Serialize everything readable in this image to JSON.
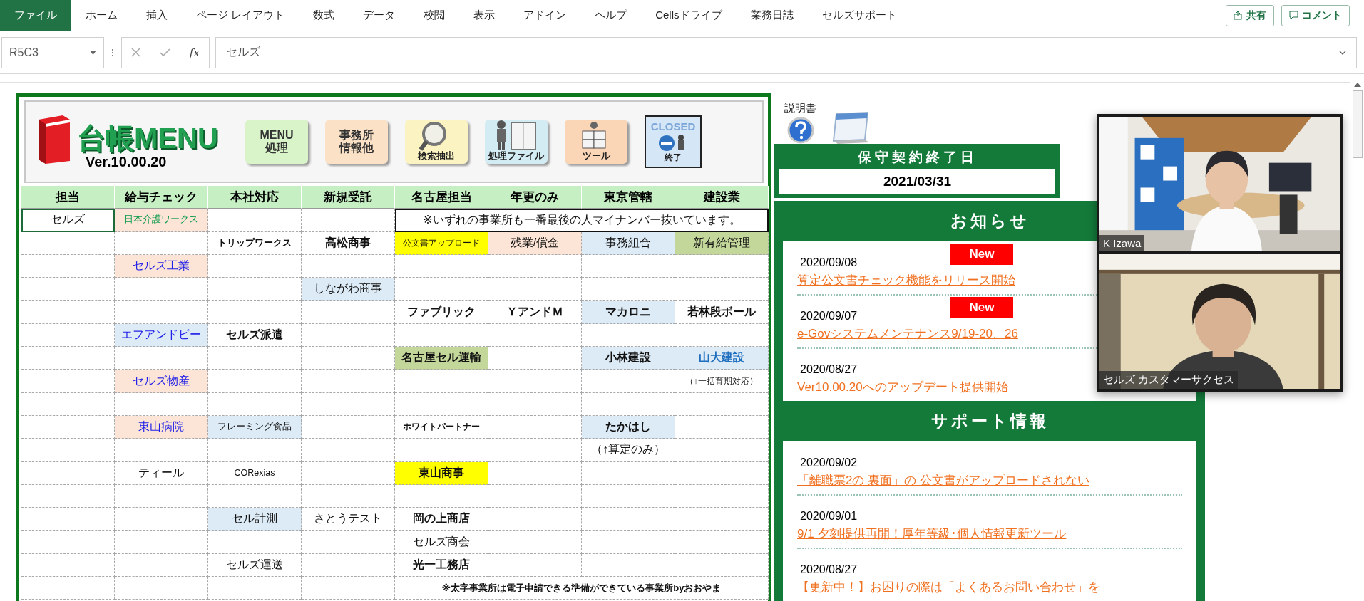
{
  "ribbon": {
    "tabs": [
      {
        "label": "ファイル",
        "selected": true
      },
      {
        "label": "ホーム",
        "selected": false
      },
      {
        "label": "挿入",
        "selected": false
      },
      {
        "label": "ページ レイアウト",
        "selected": false
      },
      {
        "label": "数式",
        "selected": false
      },
      {
        "label": "データ",
        "selected": false
      },
      {
        "label": "校閲",
        "selected": false
      },
      {
        "label": "表示",
        "selected": false
      },
      {
        "label": "アドイン",
        "selected": false
      },
      {
        "label": "ヘルプ",
        "selected": false
      },
      {
        "label": "Cellsドライブ",
        "selected": false
      },
      {
        "label": "業務日誌",
        "selected": false
      },
      {
        "label": "セルズサポート",
        "selected": false
      }
    ],
    "actions": [
      {
        "kind": "share",
        "label": "共有"
      },
      {
        "kind": "comment",
        "label": "コメント"
      }
    ]
  },
  "formula_bar": {
    "name_box": "R5C3",
    "fx": "fx",
    "value": "セルズ"
  },
  "menu": {
    "title": "台帳MENU",
    "version": "Ver.10.00.20",
    "buttons": [
      {
        "kind": "text",
        "lines": [
          "MENU",
          "処理"
        ],
        "color": "#d9f4c9"
      },
      {
        "kind": "text",
        "lines": [
          "事務所",
          "情報他"
        ],
        "color": "#fbe2c6"
      },
      {
        "kind": "search",
        "lines": [
          "検索抽出"
        ],
        "color": "#fbf3c2"
      },
      {
        "kind": "file",
        "lines": [
          "処理ファイル"
        ],
        "color": "#d3ecf3"
      },
      {
        "kind": "tool",
        "lines": [
          "ツール"
        ],
        "color": "#fad5b6"
      },
      {
        "kind": "closed",
        "lines": [
          "CLOSED",
          "終了"
        ],
        "color": "#d5e6f6"
      }
    ]
  },
  "grid": {
    "columns": [
      "担当",
      "給与チェック",
      "本社対応",
      "新規受託",
      "名古屋担当",
      "年更のみ",
      "東京管轄",
      "建設業"
    ],
    "rows": [
      {
        "cells": [
          {
            "text": "セルズ",
            "selected": true
          },
          {
            "text": "日本介護ワークス",
            "kind": "peach",
            "color": "#0a9a4a",
            "selected": false
          },
          {
            "selected": false
          },
          {
            "selected": false
          },
          {
            "text": "※いずれの事業所も一番最後の人マイナンバー抜いています。",
            "kind": "note",
            "selected": false
          }
        ]
      },
      {
        "cells": [
          {
            "selected": false
          },
          {
            "selected": false
          },
          {
            "text": "トリップワークス",
            "bold": true,
            "selected": false
          },
          {
            "text": "高松商事",
            "bold": true,
            "selected": false
          },
          {
            "text": "公文書アップロード",
            "kind": "yellow",
            "selected": false
          },
          {
            "text": "残業/償金",
            "kind": "peach",
            "selected": false
          },
          {
            "text": "事務組合",
            "kind": "blue",
            "selected": false
          },
          {
            "text": "新有給管理",
            "kind": "olive",
            "selected": false
          }
        ]
      },
      {
        "cells": [
          {
            "selected": false
          },
          {
            "text": "セルズ工業",
            "kind": "peach",
            "color": "#2020e8",
            "selected": false
          },
          {
            "selected": false
          },
          {
            "selected": false
          },
          {
            "selected": false
          },
          {
            "selected": false
          },
          {
            "selected": false
          },
          {
            "selected": false
          }
        ]
      },
      {
        "cells": [
          {
            "selected": false
          },
          {
            "selected": false
          },
          {
            "selected": false
          },
          {
            "text": "しながわ商事",
            "kind": "blue",
            "selected": false
          },
          {
            "selected": false
          },
          {
            "selected": false
          },
          {
            "selected": false
          },
          {
            "selected": false
          }
        ]
      },
      {
        "cells": [
          {
            "selected": false
          },
          {
            "selected": false
          },
          {
            "selected": false
          },
          {
            "selected": false
          },
          {
            "text": "ファブリック",
            "bold": true,
            "selected": false
          },
          {
            "text": "ＹアンドＭ",
            "bold": true,
            "selected": false
          },
          {
            "text": "マカロニ",
            "kind": "blue",
            "bold": true,
            "selected": false
          },
          {
            "text": "若林段ボール",
            "bold": true,
            "selected": false
          }
        ]
      },
      {
        "cells": [
          {
            "selected": false
          },
          {
            "text": "エフアンドビー",
            "kind": "blue",
            "color": "#2020e8",
            "selected": false
          },
          {
            "text": "セルズ派遣",
            "bold": true,
            "selected": false
          },
          {
            "selected": false
          },
          {
            "selected": false
          },
          {
            "selected": false
          },
          {
            "selected": false
          },
          {
            "selected": false
          }
        ]
      },
      {
        "cells": [
          {
            "selected": false
          },
          {
            "selected": false
          },
          {
            "selected": false
          },
          {
            "selected": false
          },
          {
            "text": "名古屋セル運輸",
            "kind": "olive",
            "bold": true,
            "selected": false
          },
          {
            "selected": false
          },
          {
            "text": "小林建設",
            "kind": "blue",
            "bold": true,
            "selected": false
          },
          {
            "text": "山大建設",
            "kind": "blue",
            "bold": true,
            "color": "#1f6fbf",
            "selected": false
          }
        ]
      },
      {
        "cells": [
          {
            "selected": false
          },
          {
            "text": "セルズ物産",
            "kind": "peach",
            "color": "#2020e8",
            "selected": false
          },
          {
            "selected": false
          },
          {
            "selected": false
          },
          {
            "selected": false
          },
          {
            "selected": false
          },
          {
            "selected": false
          },
          {
            "text": "（↑一括育期対応）",
            "selected": false
          }
        ]
      },
      {
        "cells": [
          {
            "selected": false
          },
          {
            "selected": false
          },
          {
            "selected": false
          },
          {
            "selected": false
          },
          {
            "selected": false
          },
          {
            "selected": false
          },
          {
            "selected": false
          },
          {
            "selected": false
          }
        ]
      },
      {
        "cells": [
          {
            "selected": false
          },
          {
            "text": "東山病院",
            "kind": "peach",
            "color": "#2020e8",
            "selected": false
          },
          {
            "text": "フレーミング食品",
            "kind": "blue",
            "selected": false
          },
          {
            "selected": false
          },
          {
            "text": "ホワイトパートナー",
            "bold": true,
            "selected": false
          },
          {
            "selected": false
          },
          {
            "text": "たかはし",
            "kind": "blue",
            "bold": true,
            "selected": false
          },
          {
            "selected": false
          }
        ]
      },
      {
        "cells": [
          {
            "selected": false
          },
          {
            "selected": false
          },
          {
            "selected": false
          },
          {
            "selected": false
          },
          {
            "selected": false
          },
          {
            "selected": false
          },
          {
            "text": "（↑算定のみ）",
            "selected": false
          },
          {
            "selected": false
          }
        ]
      },
      {
        "cells": [
          {
            "selected": false
          },
          {
            "text": "ティール",
            "selected": false
          },
          {
            "text": "CORexias",
            "selected": false
          },
          {
            "selected": false
          },
          {
            "text": "東山商事",
            "kind": "yellow",
            "bold": true,
            "selected": false
          },
          {
            "selected": false
          },
          {
            "selected": false
          },
          {
            "selected": false
          }
        ]
      },
      {
        "cells": [
          {
            "selected": false
          },
          {
            "selected": false
          },
          {
            "selected": false
          },
          {
            "selected": false
          },
          {
            "selected": false
          },
          {
            "selected": false
          },
          {
            "selected": false
          },
          {
            "selected": false
          }
        ]
      },
      {
        "cells": [
          {
            "selected": false
          },
          {
            "selected": false
          },
          {
            "text": "セル計測",
            "kind": "blue",
            "selected": false
          },
          {
            "text": "さとうテスト",
            "selected": false
          },
          {
            "text": "岡の上商店",
            "bold": true,
            "selected": false
          },
          {
            "selected": false
          },
          {
            "selected": false
          },
          {
            "selected": false
          }
        ]
      },
      {
        "cells": [
          {
            "selected": false
          },
          {
            "selected": false
          },
          {
            "selected": false
          },
          {
            "selected": false
          },
          {
            "text": "セルズ商会",
            "selected": false
          },
          {
            "selected": false
          },
          {
            "selected": false
          },
          {
            "selected": false
          }
        ]
      },
      {
        "cells": [
          {
            "selected": false
          },
          {
            "selected": false
          },
          {
            "text": "セルズ運送",
            "selected": false
          },
          {
            "selected": false
          },
          {
            "text": "光一工務店",
            "bold": true,
            "selected": false
          },
          {
            "selected": false
          },
          {
            "selected": false
          },
          {
            "selected": false
          }
        ]
      },
      {
        "cells": [
          {
            "selected": false
          },
          {
            "selected": false
          },
          {
            "selected": false
          },
          {
            "selected": false
          },
          {
            "text": "※太字事業所は電子申請できる準備ができている事業所byおおやま",
            "kind": "note",
            "bold": true,
            "selected": false
          }
        ]
      }
    ]
  },
  "manual": {
    "label": "説明書"
  },
  "contract": {
    "title": "保守契約終了日",
    "date": "2021/03/31"
  },
  "notices": {
    "title": "お知らせ",
    "items": [
      {
        "date": "2020/09/08",
        "title": "算定公文書チェック機能をリリース開始",
        "new": true,
        "badge": "New"
      },
      {
        "date": "2020/09/07",
        "title": "e-Govシステムメンテナンス9/19-20、26",
        "new": true,
        "badge": "New"
      },
      {
        "date": "2020/08/27",
        "title": "Ver10.00.20へのアップデート提供開始",
        "new": false
      }
    ]
  },
  "support": {
    "title": "サポート情報",
    "items": [
      {
        "date": "2020/09/02",
        "title": "「離職票2の 裏面」の 公文書がアップロードされない"
      },
      {
        "date": "2020/09/01",
        "title": "9/1 夕刻提供再開！厚年等級･個人情報更新ツール"
      },
      {
        "date": "2020/08/27",
        "title": "【更新中！】お困りの際は「よくあるお問い合わせ」を"
      }
    ]
  },
  "video_call": {
    "participants": [
      {
        "name": "K Izawa",
        "kind": "office"
      },
      {
        "name": "セルズ カスタマーサクセス",
        "kind": "home"
      }
    ]
  }
}
